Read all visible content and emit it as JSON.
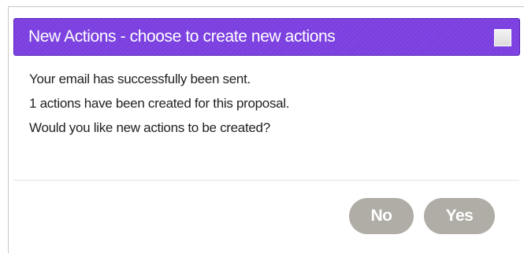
{
  "dialog": {
    "title": "New Actions - choose to create new actions",
    "messages": [
      "Your email has successfully been sent.",
      "1 actions have been created for this proposal.",
      "Would you like new actions to be created?"
    ],
    "buttons": {
      "no_label": "No",
      "yes_label": "Yes"
    }
  },
  "colors": {
    "titlebar": "#7b3fe0",
    "button": "#b0aca6",
    "text": "#222222"
  },
  "icons": {
    "close": "close-box-icon"
  }
}
